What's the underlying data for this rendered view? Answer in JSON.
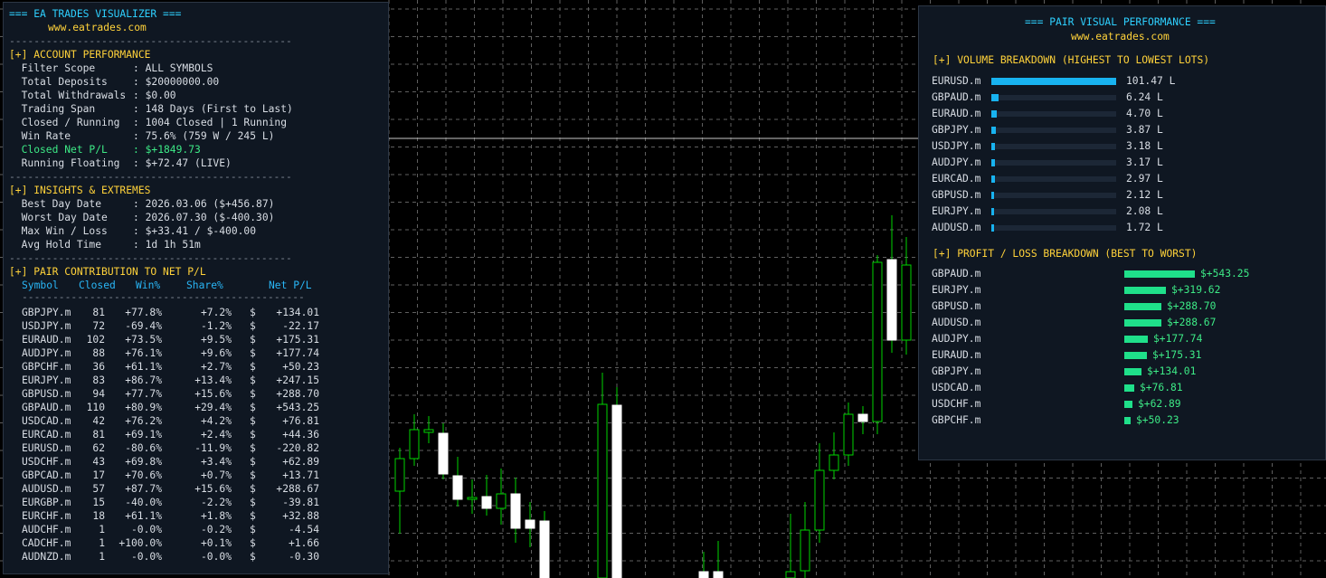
{
  "colors": {
    "panel_bg": "#0f1722",
    "cyan": "#2ed0ff",
    "yellow": "#ffd23a",
    "green": "#3dea86",
    "volume_bar": "#18b3f0",
    "pnl_bar": "#1fe08a",
    "grid": "#5f5f5f",
    "bull_candle": "#ffffff",
    "wick": "#00d400"
  },
  "left": {
    "title": "=== EA TRADES VISUALIZER ===",
    "site": "www.eatrades.com",
    "separator": "----------------------------------------------",
    "account": {
      "heading": "[+] ACCOUNT PERFORMANCE",
      "rows": [
        {
          "label": "  Filter Scope      ",
          "value": ": ALL SYMBOLS"
        },
        {
          "label": "  Total Deposits    ",
          "value": ": $20000000.00"
        },
        {
          "label": "  Total Withdrawals ",
          "value": ": $0.00"
        },
        {
          "label": "  Trading Span      ",
          "value": ": 148 Days (First to Last)"
        },
        {
          "label": "  Closed / Running  ",
          "value": ": 1004 Closed | 1 Running"
        },
        {
          "label": "  Win Rate          ",
          "value": ": 75.6% (759 W / 245 L)"
        },
        {
          "label": "  Closed Net P/L    ",
          "value": ": $+1849.73"
        },
        {
          "label": "  Running Floating  ",
          "value": ": $+72.47 (LIVE)"
        }
      ]
    },
    "insights": {
      "heading": "[+] INSIGHTS & EXTREMES",
      "rows": [
        {
          "label": "  Best Day Date     ",
          "value": ": 2026.03.06 ($+456.87)"
        },
        {
          "label": "  Worst Day Date    ",
          "value": ": 2026.07.30 ($-400.30)"
        },
        {
          "label": "  Max Win / Loss    ",
          "value": ": $+33.41 / $-400.00"
        },
        {
          "label": "  Avg Hold Time     ",
          "value": ": 1d 1h 51m"
        }
      ]
    },
    "pairs": {
      "heading": "[+] PAIR CONTRIBUTION TO NET P/L",
      "col_symbol": "Symbol",
      "col_closed": "Closed",
      "col_win": "Win%",
      "col_share": "Share%",
      "col_net": "Net P/L",
      "rows": [
        {
          "symbol": "GBPJPY.m",
          "closed": "81",
          "win": "+77.8%",
          "share": "+7.2%",
          "cur": "$",
          "net": "+134.01"
        },
        {
          "symbol": "USDJPY.m",
          "closed": "72",
          "win": "-69.4%",
          "share": "-1.2%",
          "cur": "$",
          "net": "-22.17"
        },
        {
          "symbol": "EURAUD.m",
          "closed": "102",
          "win": "+73.5%",
          "share": "+9.5%",
          "cur": "$",
          "net": "+175.31"
        },
        {
          "symbol": "AUDJPY.m",
          "closed": "88",
          "win": "+76.1%",
          "share": "+9.6%",
          "cur": "$",
          "net": "+177.74"
        },
        {
          "symbol": "GBPCHF.m",
          "closed": "36",
          "win": "+61.1%",
          "share": "+2.7%",
          "cur": "$",
          "net": "+50.23"
        },
        {
          "symbol": "EURJPY.m",
          "closed": "83",
          "win": "+86.7%",
          "share": "+13.4%",
          "cur": "$",
          "net": "+247.15"
        },
        {
          "symbol": "GBPUSD.m",
          "closed": "94",
          "win": "+77.7%",
          "share": "+15.6%",
          "cur": "$",
          "net": "+288.70"
        },
        {
          "symbol": "GBPAUD.m",
          "closed": "110",
          "win": "+80.9%",
          "share": "+29.4%",
          "cur": "$",
          "net": "+543.25"
        },
        {
          "symbol": "USDCAD.m",
          "closed": "42",
          "win": "+76.2%",
          "share": "+4.2%",
          "cur": "$",
          "net": "+76.81"
        },
        {
          "symbol": "EURCAD.m",
          "closed": "81",
          "win": "+69.1%",
          "share": "+2.4%",
          "cur": "$",
          "net": "+44.36"
        },
        {
          "symbol": "EURUSD.m",
          "closed": "62",
          "win": "-80.6%",
          "share": "-11.9%",
          "cur": "$",
          "net": "-220.82"
        },
        {
          "symbol": "USDCHF.m",
          "closed": "43",
          "win": "+69.8%",
          "share": "+3.4%",
          "cur": "$",
          "net": "+62.89"
        },
        {
          "symbol": "GBPCAD.m",
          "closed": "17",
          "win": "+70.6%",
          "share": "+0.7%",
          "cur": "$",
          "net": "+13.71"
        },
        {
          "symbol": "AUDUSD.m",
          "closed": "57",
          "win": "+87.7%",
          "share": "+15.6%",
          "cur": "$",
          "net": "+288.67"
        },
        {
          "symbol": "EURGBP.m",
          "closed": "15",
          "win": "-40.0%",
          "share": "-2.2%",
          "cur": "$",
          "net": "-39.81"
        },
        {
          "symbol": "EURCHF.m",
          "closed": "18",
          "win": "+61.1%",
          "share": "+1.8%",
          "cur": "$",
          "net": "+32.88"
        },
        {
          "symbol": "AUDCHF.m",
          "closed": "1",
          "win": "-0.0%",
          "share": "-0.2%",
          "cur": "$",
          "net": "-4.54"
        },
        {
          "symbol": "CADCHF.m",
          "closed": "1",
          "win": "+100.0%",
          "share": "+0.1%",
          "cur": "$",
          "net": "+1.66"
        },
        {
          "symbol": "AUDNZD.m",
          "closed": "1",
          "win": "-0.0%",
          "share": "-0.0%",
          "cur": "$",
          "net": "-0.30"
        }
      ]
    }
  },
  "right": {
    "title": "=== PAIR VISUAL PERFORMANCE ===",
    "site": "www.eatrades.com",
    "volume": {
      "heading": "[+] VOLUME BREAKDOWN (HIGHEST TO LOWEST LOTS)",
      "max": 101.47,
      "rows": [
        {
          "symbol": "EURUSD.m",
          "value": 101.47,
          "label": "101.47 L"
        },
        {
          "symbol": "GBPAUD.m",
          "value": 6.24,
          "label": "6.24 L"
        },
        {
          "symbol": "EURAUD.m",
          "value": 4.7,
          "label": "4.70 L"
        },
        {
          "symbol": "GBPJPY.m",
          "value": 3.87,
          "label": "3.87 L"
        },
        {
          "symbol": "USDJPY.m",
          "value": 3.18,
          "label": "3.18 L"
        },
        {
          "symbol": "AUDJPY.m",
          "value": 3.17,
          "label": "3.17 L"
        },
        {
          "symbol": "EURCAD.m",
          "value": 2.97,
          "label": "2.97 L"
        },
        {
          "symbol": "GBPUSD.m",
          "value": 2.12,
          "label": "2.12 L"
        },
        {
          "symbol": "EURJPY.m",
          "value": 2.08,
          "label": "2.08 L"
        },
        {
          "symbol": "AUDUSD.m",
          "value": 1.72,
          "label": "1.72 L"
        }
      ]
    },
    "pnl": {
      "heading": "[+] PROFIT / LOSS BREAKDOWN (BEST TO WORST)",
      "max": 543.25,
      "rows": [
        {
          "symbol": "GBPAUD.m",
          "value": 543.25,
          "label": "$+543.25"
        },
        {
          "symbol": "EURJPY.m",
          "value": 319.62,
          "label": "$+319.62"
        },
        {
          "symbol": "GBPUSD.m",
          "value": 288.7,
          "label": "$+288.70"
        },
        {
          "symbol": "AUDUSD.m",
          "value": 288.67,
          "label": "$+288.67"
        },
        {
          "symbol": "AUDJPY.m",
          "value": 177.74,
          "label": "$+177.74"
        },
        {
          "symbol": "EURAUD.m",
          "value": 175.31,
          "label": "$+175.31"
        },
        {
          "symbol": "GBPJPY.m",
          "value": 134.01,
          "label": "$+134.01"
        },
        {
          "symbol": "USDCAD.m",
          "value": 76.81,
          "label": "$+76.81"
        },
        {
          "symbol": "USDCHF.m",
          "value": 62.89,
          "label": "$+62.89"
        },
        {
          "symbol": "GBPCHF.m",
          "value": 50.23,
          "label": "$+50.23"
        }
      ]
    }
  }
}
